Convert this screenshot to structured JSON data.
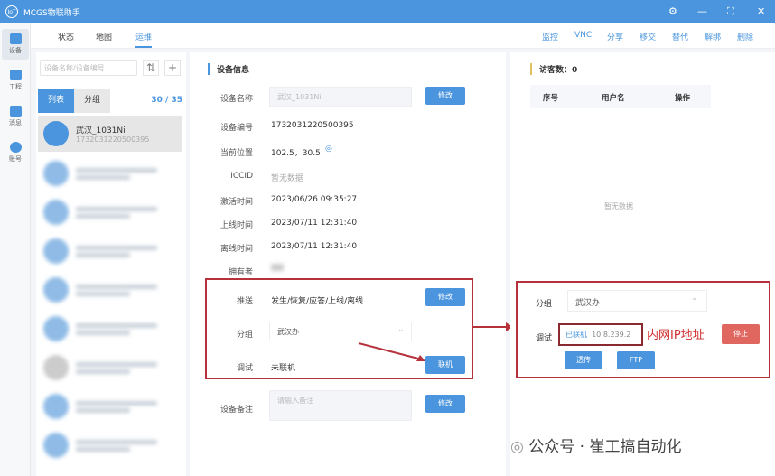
{
  "app": {
    "title": "MCGS物联助手"
  },
  "rail": [
    {
      "label": "设备"
    },
    {
      "label": "工程"
    },
    {
      "label": "消息"
    },
    {
      "label": "账号"
    }
  ],
  "tabs": [
    "状态",
    "地图",
    "运维"
  ],
  "actions": [
    "监控",
    "VNC",
    "分享",
    "移交",
    "替代",
    "解绑",
    "删除"
  ],
  "left": {
    "search_placeholder": "设备名称/设备编号",
    "list_tab": "列表",
    "group_tab": "分组",
    "count": "30 / 35",
    "selected": {
      "name": "武汉_1031Ni",
      "id": "1732031220500395"
    }
  },
  "info": {
    "section": "设备信息",
    "fields": [
      {
        "label": "设备名称",
        "value": "武汉_1031Ni"
      },
      {
        "label": "设备编号",
        "value": "1732031220500395"
      },
      {
        "label": "当前位置",
        "value": "102.5，30.5"
      },
      {
        "label": "ICCID",
        "value": "暂无数据"
      },
      {
        "label": "激活时间",
        "value": "2023/06/26 09:35:27"
      },
      {
        "label": "上线时间",
        "value": "2023/07/11 12:31:40"
      },
      {
        "label": "离线时间",
        "value": "2023/07/11 12:31:40"
      },
      {
        "label": "拥有者",
        "value": ""
      }
    ],
    "edit": "修改",
    "push_label": "推送",
    "push_value": "发生/恢复/应答/上线/离线",
    "group_label": "分组",
    "group_value": "武汉办",
    "debug_label": "调试",
    "debug_value": "未联机",
    "connect": "联机",
    "note_label": "设备备注",
    "note_placeholder": "请输入备注"
  },
  "visitors": {
    "title": "访客数：0",
    "cols": [
      "序号",
      "用户名",
      "操作"
    ],
    "empty": "暂无数据"
  },
  "debug_panel": {
    "group_label": "分组",
    "group_value": "武汉办",
    "debug_label": "调试",
    "status": "已联机",
    "ip": "10.8.239.2",
    "stop": "停止",
    "passthrough": "透传",
    "ftp": "FTP"
  },
  "annotation": "内网IP地址",
  "watermark": "公众号 · 崔工搞自动化"
}
